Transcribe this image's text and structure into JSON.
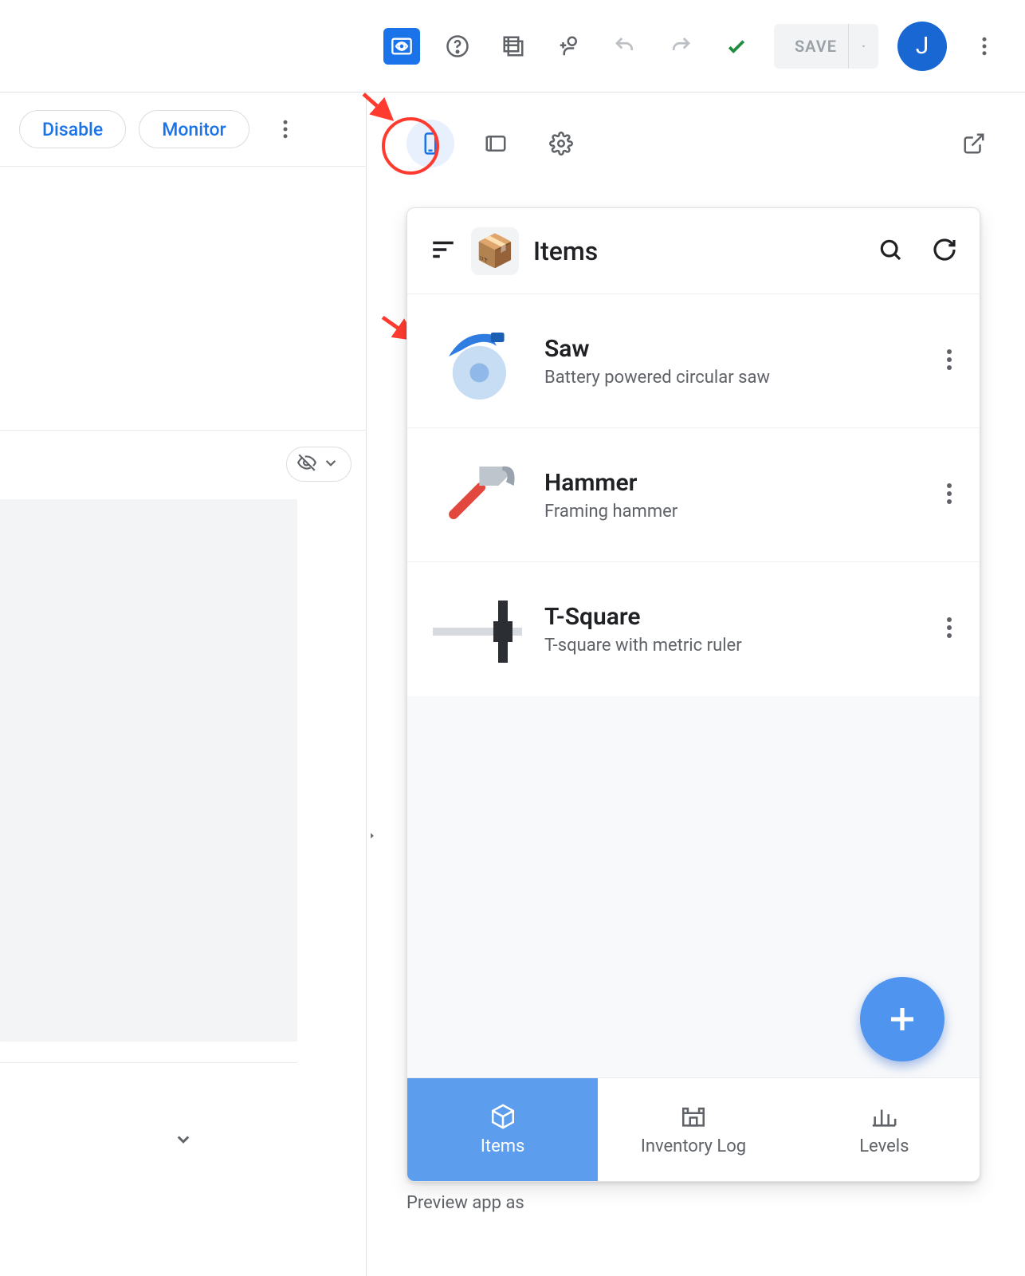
{
  "toolbar": {
    "save_label": "SAVE",
    "avatar_initial": "J"
  },
  "left": {
    "disable_label": "Disable",
    "monitor_label": "Monitor"
  },
  "app": {
    "title": "Items",
    "icon": "📦",
    "items": [
      {
        "title": "Saw",
        "subtitle": "Battery powered circular saw"
      },
      {
        "title": "Hammer",
        "subtitle": "Framing hammer"
      },
      {
        "title": "T-Square",
        "subtitle": "T-square with metric ruler"
      }
    ],
    "nav": [
      {
        "label": "Items",
        "active": true
      },
      {
        "label": "Inventory Log",
        "active": false
      },
      {
        "label": "Levels",
        "active": false
      }
    ]
  },
  "footer": {
    "preview_label": "Preview app as"
  }
}
